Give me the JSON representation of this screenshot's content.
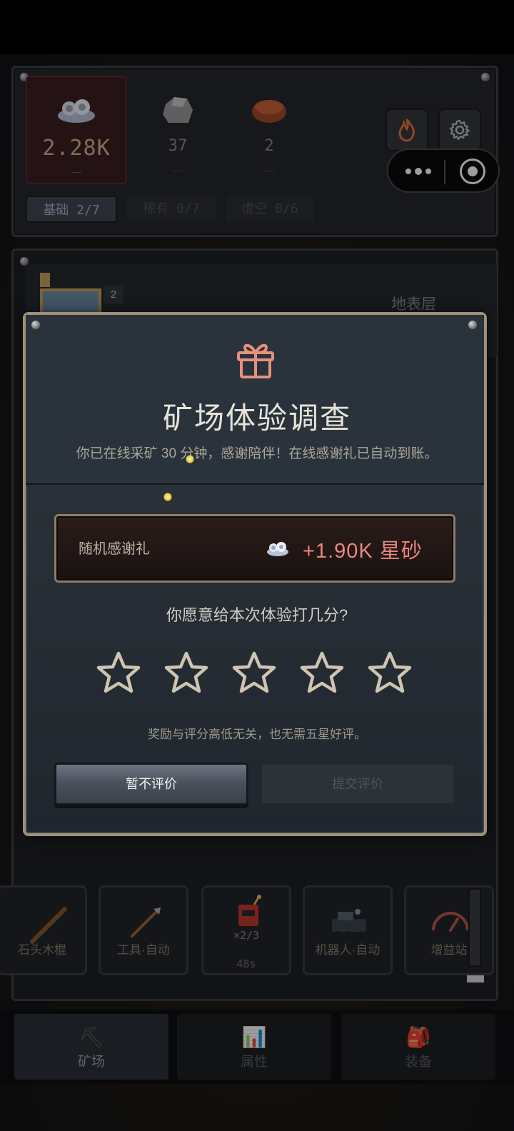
{
  "resources": [
    {
      "icon": "stardust-icon",
      "value": "2.28K",
      "delta": "—"
    },
    {
      "icon": "stone-icon",
      "value": "37",
      "delta": "—"
    },
    {
      "icon": "copper-icon",
      "value": "2",
      "delta": "—"
    }
  ],
  "tiers": [
    {
      "label": "基础 2/7"
    },
    {
      "label": "稀有 0/7"
    },
    {
      "label": "虚空 0/6"
    }
  ],
  "layer": {
    "title": "地表层",
    "badge": "2"
  },
  "tools": [
    {
      "label": "石头木棍"
    },
    {
      "label": "工具·自动"
    },
    {
      "count": "×2/3",
      "timer": "48s"
    },
    {
      "label": "机器人·自动"
    },
    {
      "label": "增益站"
    }
  ],
  "nav": [
    {
      "label": "矿场",
      "icon": "⛏"
    },
    {
      "label": "属性",
      "icon": "📊"
    },
    {
      "label": "装备",
      "icon": "🎒"
    }
  ],
  "dialog": {
    "title": "矿场体验调查",
    "subtitle": "你已在线采矿 30 分钟，感谢陪伴！在线感谢礼已自动到账。",
    "reward_label": "随机感谢礼",
    "reward_amount": "+1.90K 星砂",
    "question": "你愿意给本次体验打几分?",
    "rating": 0,
    "rating_max": 5,
    "hint": "奖励与评分高低无关，也无需五星好评。",
    "skip_label": "暂不评价",
    "submit_label": "提交评价"
  },
  "colors": {
    "accent": "#e9867e",
    "gold_border": "#a08f78",
    "star_outline": "#cfc4b2"
  }
}
